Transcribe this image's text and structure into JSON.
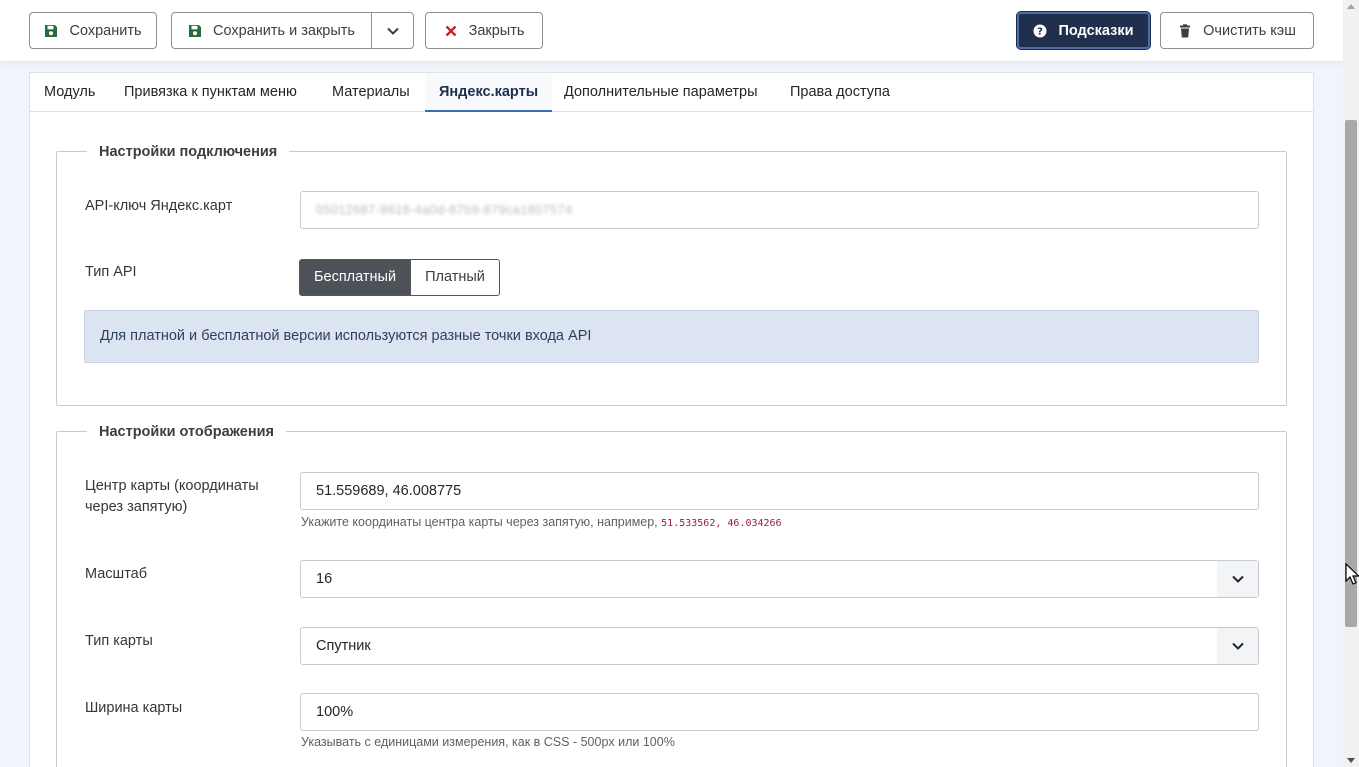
{
  "toolbar": {
    "save": "Сохранить",
    "save_close": "Сохранить и закрыть",
    "close": "Закрыть",
    "help": "Подсказки",
    "clear_cache": "Очистить кэш"
  },
  "tabs": [
    {
      "label": "Модуль"
    },
    {
      "label": "Привязка к пунктам меню"
    },
    {
      "label": "Материалы"
    },
    {
      "label": "Яндекс.карты"
    },
    {
      "label": "Дополнительные параметры"
    },
    {
      "label": "Права доступа"
    }
  ],
  "connection": {
    "legend": "Настройки подключения",
    "api_key_label": "API-ключ Яндекс.карт",
    "api_key_value": "05012687-9618-4a0d-87b9-879ca1807574",
    "api_type_label": "Тип API",
    "api_type_options": [
      "Бесплатный",
      "Платный"
    ],
    "api_type_selected": "Бесплатный",
    "note": "Для платной и бесплатной версии используются разные точки входа API"
  },
  "display": {
    "legend": "Настройки отображения",
    "center_label": "Центр карты (координаты через запятую)",
    "center_value": "51.559689, 46.008775",
    "center_hint": "Укажите координаты центра карты через запятую, например,",
    "center_hint_example": "51.533562, 46.034266",
    "zoom_label": "Масштаб",
    "zoom_value": "16",
    "type_label": "Тип карты",
    "type_value": "Спутник",
    "width_label": "Ширина карты",
    "width_value": "100%",
    "width_hint": "Указывать с единицами измерения, как в CSS - 500px или 100%"
  },
  "colors": {
    "help_bg": "#1f2f4c",
    "active_tab_border": "#3b6ab7",
    "alert_bg": "#dde4f1",
    "save_icon": "#2e6b3a",
    "close_icon": "#c4242b"
  },
  "icons": {
    "save": "floppy-disk-icon",
    "close": "x-mark-icon",
    "help": "question-circle-icon",
    "cache": "trash-icon",
    "dropdown": "chevron-down-icon"
  }
}
